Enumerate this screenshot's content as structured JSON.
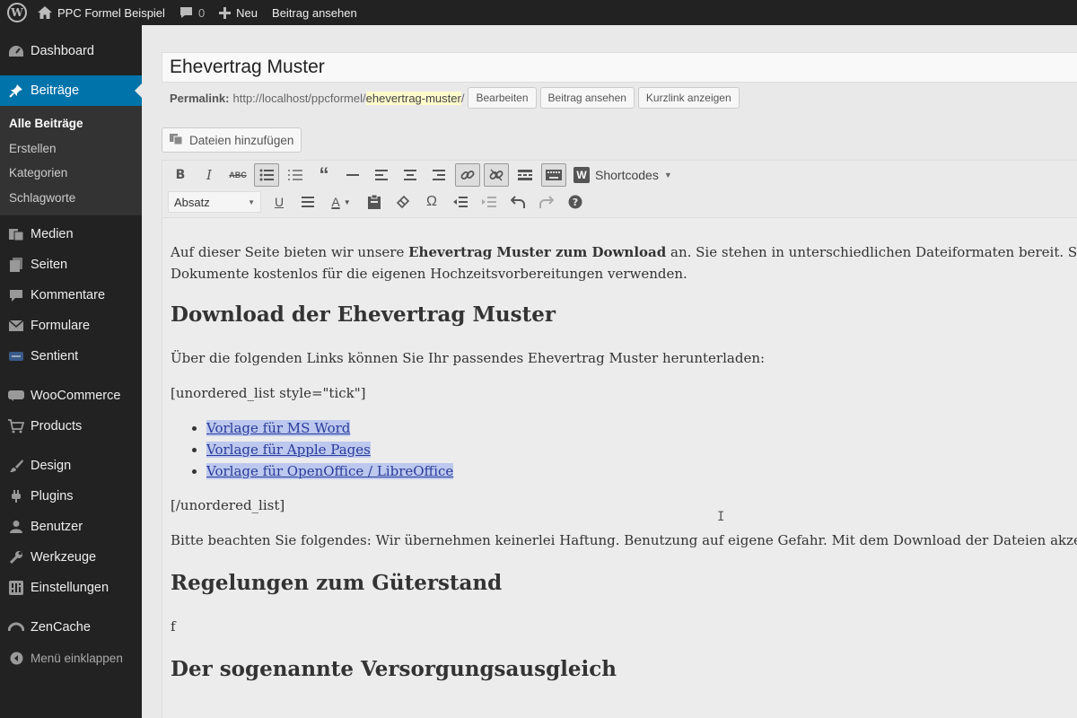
{
  "adminbar": {
    "site_name": "PPC Formel Beispiel",
    "comments_count": "0",
    "new_label": "Neu",
    "view_post_label": "Beitrag ansehen",
    "logo_letter": "W"
  },
  "sidebar": {
    "items": [
      {
        "label": "Dashboard",
        "icon": "dashboard-icon"
      },
      {
        "label": "Beiträge",
        "icon": "pin-icon"
      },
      {
        "label": "Medien",
        "icon": "media-icon"
      },
      {
        "label": "Seiten",
        "icon": "pages-icon"
      },
      {
        "label": "Kommentare",
        "icon": "comments-icon"
      },
      {
        "label": "Formulare",
        "icon": "mail-icon"
      },
      {
        "label": "Sentient",
        "icon": "sentient-icon"
      },
      {
        "label": "WooCommerce",
        "icon": "woocommerce-icon"
      },
      {
        "label": "Products",
        "icon": "cart-icon"
      },
      {
        "label": "Design",
        "icon": "brush-icon"
      },
      {
        "label": "Plugins",
        "icon": "plugin-icon"
      },
      {
        "label": "Benutzer",
        "icon": "user-icon"
      },
      {
        "label": "Werkzeuge",
        "icon": "wrench-icon"
      },
      {
        "label": "Einstellungen",
        "icon": "settings-icon"
      },
      {
        "label": "ZenCache",
        "icon": "zencache-icon"
      },
      {
        "label": "Menü einklappen",
        "icon": "collapse-icon"
      }
    ],
    "submenu": [
      {
        "label": "Alle Beiträge"
      },
      {
        "label": "Erstellen"
      },
      {
        "label": "Kategorien"
      },
      {
        "label": "Schlagworte"
      }
    ]
  },
  "editor": {
    "post_title": "Ehevertrag Muster",
    "permalink_label": "Permalink:",
    "permalink_base": "http://localhost/ppcformel/",
    "permalink_slug": "ehevertrag-muster",
    "permalink_trailing": "/",
    "edit_label": "Bearbeiten",
    "view_label": "Beitrag ansehen",
    "shortlink_label": "Kurzlink anzeigen",
    "add_media_label": "Dateien hinzufügen",
    "format_select": "Absatz",
    "shortcodes_label": "Shortcodes"
  },
  "body": {
    "p1_before": "Auf dieser Seite bieten wir unsere ",
    "p1_bold": "Ehevertrag Muster zum Download",
    "p1_after": " an. Sie stehen in unterschiedlichen Dateiformaten bereit. Sie können d",
    "p1_line2": "Dokumente kostenlos für die eigenen Hochzeitsvorbereitungen verwenden.",
    "h1": "Download der Ehevertrag Muster",
    "p2": "Über die folgenden Links können Sie Ihr passendes Ehevertrag Muster herunterladen:",
    "p3": "[unordered_list style=\"tick\"]",
    "links": [
      "Vorlage für MS Word",
      "Vorlage für Apple Pages",
      "Vorlage für OpenOffice / LibreOffice"
    ],
    "p4": "[/unordered_list]",
    "p5": "Bitte beachten Sie folgendes: Wir übernehmen keinerlei Haftung. Benutzung auf eigene Gefahr. Mit dem Download der Dateien akzeptieren Sie d",
    "h2": "Regelungen zum Güterstand",
    "p6": "f",
    "h3": "Der sogenannte Versorgungsausgleich"
  },
  "colors": {
    "admin_dark": "#222222",
    "accent_blue": "#0073aa",
    "link_highlight": "#bcc8ee"
  }
}
